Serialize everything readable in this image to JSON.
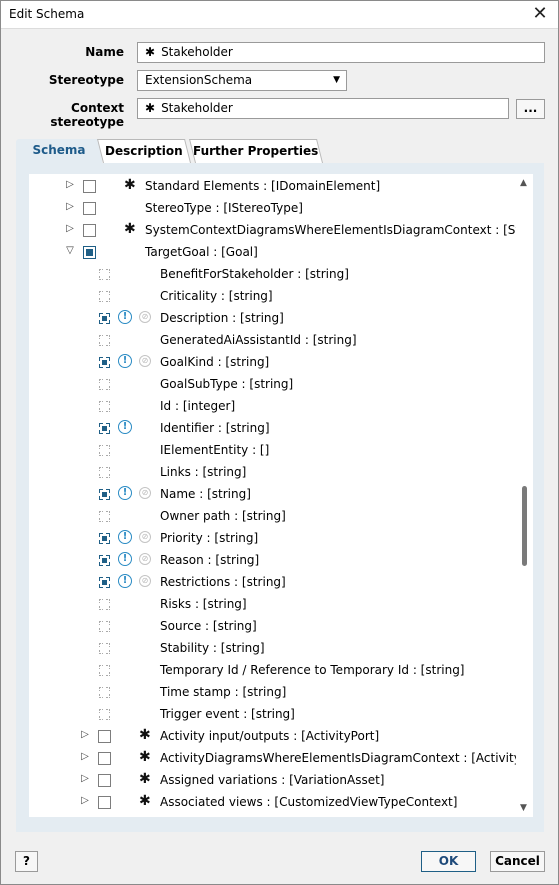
{
  "window": {
    "title": "Edit Schema",
    "close": "✕"
  },
  "form": {
    "name_label": "Name",
    "name_value": "Stakeholder",
    "stereotype_label": "Stereotype",
    "stereotype_value": "ExtensionSchema",
    "context_label": "Context stereotype",
    "context_value": "Stakeholder",
    "browse_label": "...",
    "marker": "✱"
  },
  "tabs": [
    {
      "label": "Schema",
      "active": true
    },
    {
      "label": "Description",
      "active": false
    },
    {
      "label": "Further Properties",
      "active": false
    }
  ],
  "tree": {
    "rows": [
      {
        "depth": 0,
        "expander": "▷",
        "checkbox": "empty",
        "symbol": "✱",
        "label": "Standard Elements : [IDomainElement]"
      },
      {
        "depth": 0,
        "expander": "▷",
        "checkbox": "empty",
        "symbol": "",
        "label": "StereoType : [IStereoType]"
      },
      {
        "depth": 0,
        "expander": "▷",
        "checkbox": "empty",
        "symbol": "✱",
        "label": "SystemContextDiagramsWhereElementIsDiagramContext : [SystemContextDiagram]"
      },
      {
        "depth": 0,
        "expander": "▽",
        "checkbox": "full",
        "symbol": "",
        "label": "TargetGoal : [Goal]"
      },
      {
        "depth": 1,
        "state": "off",
        "mandatory": false,
        "readonly": false,
        "label": "BenefitForStakeholder : [string]"
      },
      {
        "depth": 1,
        "state": "off",
        "mandatory": false,
        "readonly": false,
        "label": "Criticality : [string]"
      },
      {
        "depth": 1,
        "state": "on",
        "mandatory": true,
        "readonly": true,
        "label": "Description : [string]"
      },
      {
        "depth": 1,
        "state": "off",
        "mandatory": false,
        "readonly": false,
        "label": "GeneratedAiAssistantId : [string]"
      },
      {
        "depth": 1,
        "state": "on",
        "mandatory": true,
        "readonly": true,
        "label": "GoalKind : [string]"
      },
      {
        "depth": 1,
        "state": "off",
        "mandatory": false,
        "readonly": false,
        "label": "GoalSubType : [string]"
      },
      {
        "depth": 1,
        "state": "off",
        "mandatory": false,
        "readonly": false,
        "label": "Id : [integer]"
      },
      {
        "depth": 1,
        "state": "on",
        "mandatory": true,
        "readonly": false,
        "label": "Identifier : [string]"
      },
      {
        "depth": 1,
        "state": "off",
        "mandatory": false,
        "readonly": false,
        "label": "IElementEntity : []"
      },
      {
        "depth": 1,
        "state": "off",
        "mandatory": false,
        "readonly": false,
        "label": "Links : [string]"
      },
      {
        "depth": 1,
        "state": "on",
        "mandatory": true,
        "readonly": true,
        "label": "Name : [string]"
      },
      {
        "depth": 1,
        "state": "off",
        "mandatory": false,
        "readonly": false,
        "label": "Owner path : [string]"
      },
      {
        "depth": 1,
        "state": "on",
        "mandatory": true,
        "readonly": true,
        "label": "Priority : [string]"
      },
      {
        "depth": 1,
        "state": "on",
        "mandatory": true,
        "readonly": true,
        "label": "Reason : [string]"
      },
      {
        "depth": 1,
        "state": "on",
        "mandatory": true,
        "readonly": true,
        "label": "Restrictions : [string]"
      },
      {
        "depth": 1,
        "state": "off",
        "mandatory": false,
        "readonly": false,
        "label": "Risks : [string]"
      },
      {
        "depth": 1,
        "state": "off",
        "mandatory": false,
        "readonly": false,
        "label": "Source : [string]"
      },
      {
        "depth": 1,
        "state": "off",
        "mandatory": false,
        "readonly": false,
        "label": "Stability : [string]"
      },
      {
        "depth": 1,
        "state": "off",
        "mandatory": false,
        "readonly": false,
        "label": "Temporary Id / Reference to Temporary Id : [string]"
      },
      {
        "depth": 1,
        "state": "off",
        "mandatory": false,
        "readonly": false,
        "label": "Time stamp : [string]"
      },
      {
        "depth": 1,
        "state": "off",
        "mandatory": false,
        "readonly": false,
        "label": "Trigger event : [string]"
      },
      {
        "depth": 2,
        "expander": "▷",
        "checkbox": "empty",
        "symbol": "✱",
        "label": "Activity input/outputs : [ActivityPort]"
      },
      {
        "depth": 2,
        "expander": "▷",
        "checkbox": "empty",
        "symbol": "✱",
        "label": "ActivityDiagramsWhereElementIsDiagramContext : [ActivityDiagram]"
      },
      {
        "depth": 2,
        "expander": "▷",
        "checkbox": "empty",
        "symbol": "✱",
        "label": "Assigned variations : [VariationAsset]"
      },
      {
        "depth": 2,
        "expander": "▷",
        "checkbox": "empty",
        "symbol": "✱",
        "label": "Associated views : [CustomizedViewTypeContext]"
      }
    ]
  },
  "icons": {
    "mandatory": "!",
    "readonly": "⊘"
  },
  "buttons": {
    "help": "?",
    "ok": "OK",
    "cancel": "Cancel"
  },
  "colors": {
    "accent": "#1f5f86",
    "panel": "#e4ecf2",
    "info": "#2a8bc4"
  }
}
